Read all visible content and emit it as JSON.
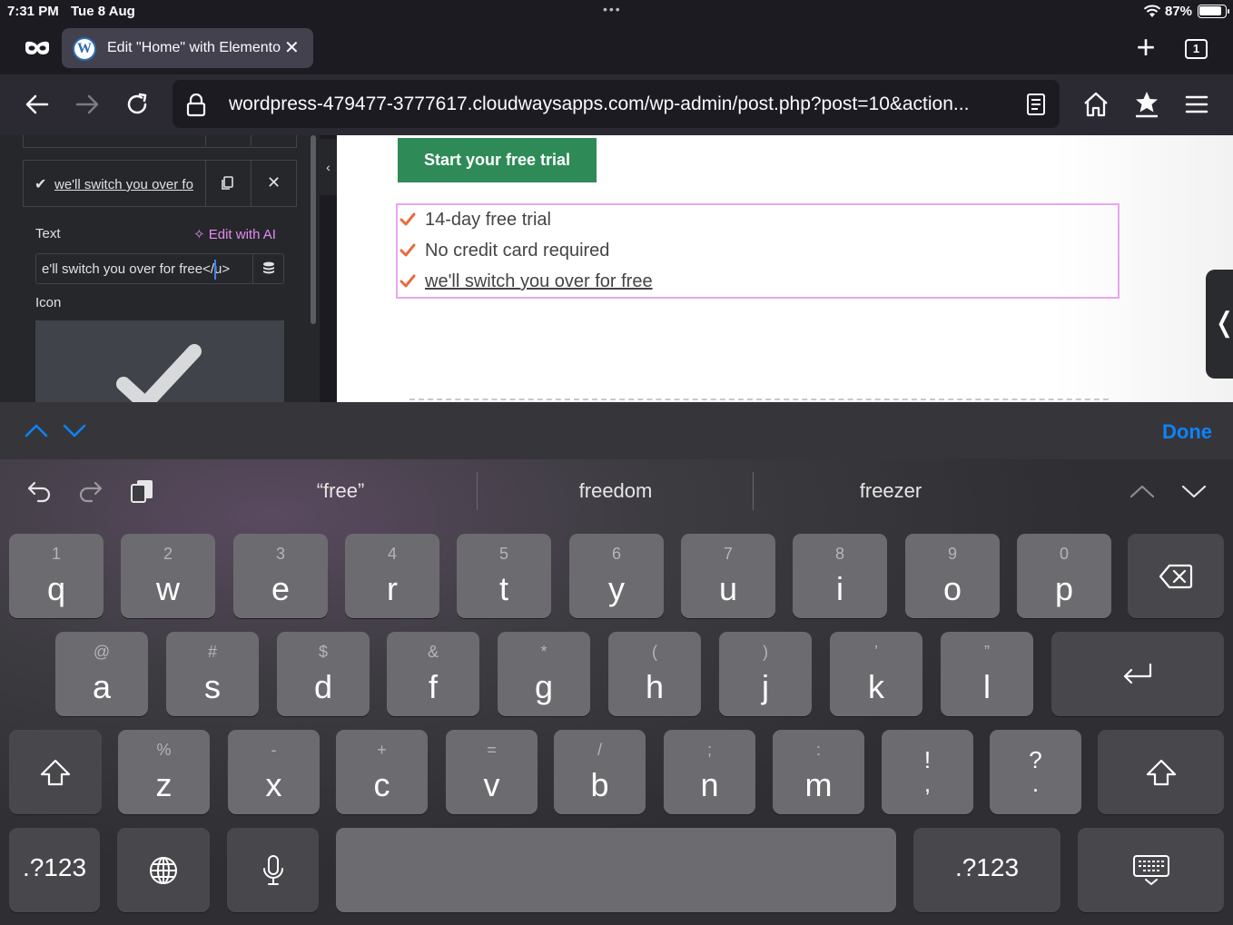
{
  "status": {
    "time": "7:31 PM",
    "date": "Tue 8 Aug",
    "battery": "87%"
  },
  "tab": {
    "title": "Edit \"Home\" with Elemento",
    "wp_glyph": "W",
    "count": "1"
  },
  "url": "wordpress-479477-3777617.cloudwaysapps.com/wp-admin/post.php?post=10&action...",
  "icons": [
    "private-mode-icon",
    "wordpress-icon",
    "close-icon",
    "plus-icon",
    "tab-count-icon",
    "back-icon",
    "forward-icon",
    "reload-icon",
    "lock-icon",
    "reader-icon",
    "home-icon",
    "bookmark-star-icon",
    "menu-icon",
    "check-icon",
    "duplicate-icon",
    "sparkle-icon",
    "database-icon",
    "chevron-left-icon",
    "undo-icon",
    "redo-icon",
    "paste-icon",
    "chevron-up-icon",
    "chevron-down-icon",
    "backspace-icon",
    "return-icon",
    "shift-icon",
    "globe-icon",
    "microphone-icon",
    "keyboard-dismiss-icon"
  ],
  "panel": {
    "item_label": "we'll switch you over fo",
    "text_label": "Text",
    "ai_label": "Edit with AI",
    "text_value": "e'll switch you over for free</u>",
    "icon_label": "Icon"
  },
  "canvas": {
    "cta": "Start your free trial",
    "items": [
      "14-day free trial",
      "No credit card required",
      "we'll switch you over for free"
    ]
  },
  "accessory": {
    "done": "Done"
  },
  "keyboard": {
    "suggestions": [
      "“free”",
      "freedom",
      "freezer"
    ],
    "row1": [
      {
        "sub": "1",
        "main": "q"
      },
      {
        "sub": "2",
        "main": "w"
      },
      {
        "sub": "3",
        "main": "e"
      },
      {
        "sub": "4",
        "main": "r"
      },
      {
        "sub": "5",
        "main": "t"
      },
      {
        "sub": "6",
        "main": "y"
      },
      {
        "sub": "7",
        "main": "u"
      },
      {
        "sub": "8",
        "main": "i"
      },
      {
        "sub": "9",
        "main": "o"
      },
      {
        "sub": "0",
        "main": "p"
      }
    ],
    "row2": [
      {
        "sub": "@",
        "main": "a"
      },
      {
        "sub": "#",
        "main": "s"
      },
      {
        "sub": "$",
        "main": "d"
      },
      {
        "sub": "&",
        "main": "f"
      },
      {
        "sub": "*",
        "main": "g"
      },
      {
        "sub": "(",
        "main": "h"
      },
      {
        "sub": ")",
        "main": "j"
      },
      {
        "sub": "’",
        "main": "k"
      },
      {
        "sub": "”",
        "main": "l"
      }
    ],
    "row3": [
      {
        "sub": "%",
        "main": "z"
      },
      {
        "sub": "-",
        "main": "x"
      },
      {
        "sub": "+",
        "main": "c"
      },
      {
        "sub": "=",
        "main": "v"
      },
      {
        "sub": "/",
        "main": "b"
      },
      {
        "sub": ";",
        "main": "n"
      },
      {
        "sub": ":",
        "main": "m"
      },
      {
        "sub": "!",
        "main": ","
      },
      {
        "sub": "?",
        "main": "."
      }
    ],
    "numbers_label": ".?123"
  }
}
